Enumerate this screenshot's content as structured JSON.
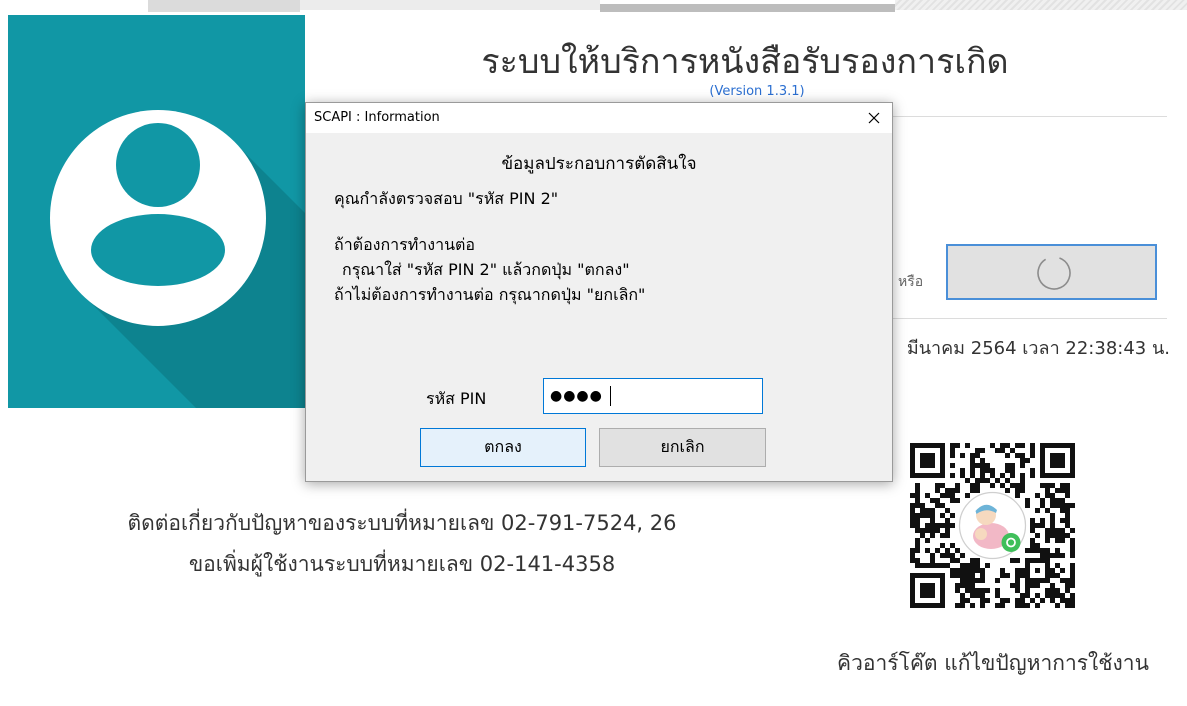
{
  "app": {
    "title": "ระบบให้บริการหนังสือรับรองการเกิด",
    "version": "(Version 1.3.1)",
    "or_label": "หรือ",
    "datetime": "มีนาคม 2564 เวลา 22:38:43 น.",
    "contact_line1": "ติดต่อเกี่ยวกับปัญหาของระบบที่หมายเลข 02-791-7524, 26",
    "contact_line2": "ขอเพิ่มผู้ใช้งานระบบที่หมายเลข 02-141-4358",
    "qr_caption": "คิวอาร์โค๊ต แก้ไขปัญหาการใช้งาน"
  },
  "dialog": {
    "title": "SCAPI : Information",
    "heading": "ข้อมูลประกอบการตัดสินใจ",
    "message_line1": "คุณกำลังตรวจสอบ \"รหัส PIN 2\"",
    "message_line2": "ถ้าต้องการทำงานต่อ",
    "message_line3": "กรุณาใส่ \"รหัส PIN 2\" แล้วกดปุ่ม \"ตกลง\"",
    "message_line4": "ถ้าไม่ต้องการทำงานต่อ กรุณากดปุ่ม \"ยกเลิก\"",
    "pin_label": "รหัส PIN",
    "pin_value": "●●●●",
    "ok_label": "ตกลง",
    "cancel_label": "ยกเลิก"
  },
  "icons": {
    "avatar": "user-avatar-icon",
    "close": "close-icon",
    "spinner": "loading-spinner-icon",
    "qr": "qr-code",
    "qr_logo": "nurse-baby-logo",
    "line_badge": "line-badge-icon"
  },
  "colors": {
    "teal": "#1197a5",
    "teal_shadow": "#0d838f",
    "version_blue": "#2b6fd1",
    "focus_blue": "#0078d7",
    "dialog_bg": "#f0f0f0",
    "button_gray": "#e1e1e1",
    "line_green": "#3fbf5a"
  }
}
